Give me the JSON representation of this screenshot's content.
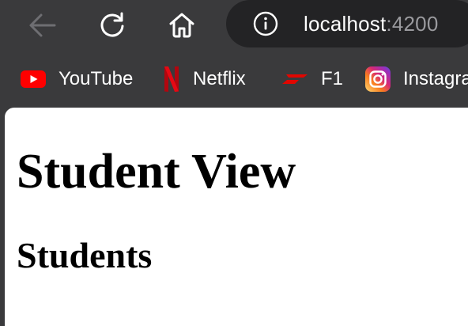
{
  "browser": {
    "nav": {
      "back_icon": "arrow-left-icon",
      "reload_icon": "reload-icon",
      "home_icon": "home-icon"
    },
    "address_bar": {
      "info_icon": "info-icon",
      "host": "localhost",
      "port": ":4200"
    },
    "bookmarks": [
      {
        "label": "YouTube",
        "icon": "youtube-icon",
        "color": "#ff0000"
      },
      {
        "label": "Netflix",
        "icon": "netflix-icon",
        "color": "#e50914"
      },
      {
        "label": "F1",
        "icon": "f1-icon",
        "color": "#e10600"
      },
      {
        "label": "Instagra",
        "icon": "instagram-icon",
        "color": "#d6249f"
      }
    ],
    "chrome_color": "#3a3a3c"
  },
  "page": {
    "title": "Student View",
    "section_heading": "Students"
  }
}
